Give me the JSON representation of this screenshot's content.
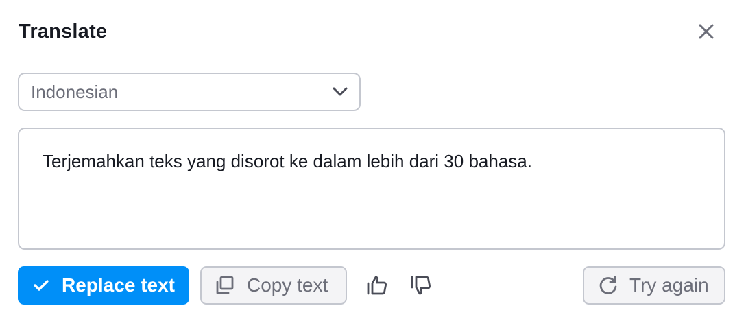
{
  "dialog": {
    "title": "Translate",
    "close_icon": "close-icon"
  },
  "language_select": {
    "selected": "Indonesian",
    "icon": "chevron-down-icon"
  },
  "translation": {
    "text": "Terjemahkan teks yang disorot ke dalam lebih dari 30 bahasa."
  },
  "actions": {
    "replace_label": "Replace text",
    "replace_icon": "check-icon",
    "copy_label": "Copy text",
    "copy_icon": "copy-icon",
    "thumbs_up_icon": "thumbs-up-icon",
    "thumbs_down_icon": "thumbs-down-icon",
    "retry_label": "Try again",
    "retry_icon": "refresh-icon"
  },
  "colors": {
    "primary": "#008ff8",
    "border": "#c4c7cf",
    "muted_text": "#6c6e79",
    "text": "#171a22",
    "secondary_bg": "#f4f4f6"
  }
}
